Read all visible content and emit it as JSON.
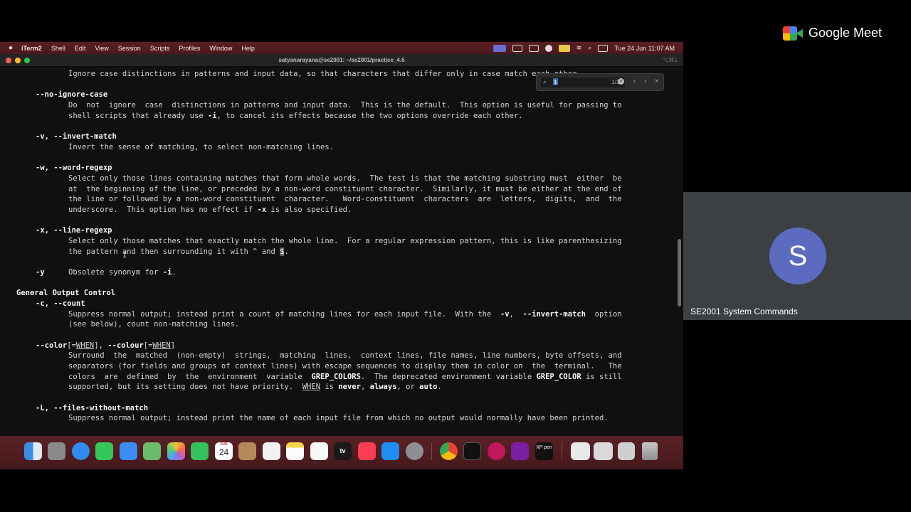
{
  "menubar": {
    "app_name": "iTerm2",
    "items": [
      "Shell",
      "Edit",
      "View",
      "Session",
      "Scripts",
      "Profiles",
      "Window",
      "Help"
    ],
    "clock": "Tue 24 Jun  11:07 AM"
  },
  "window": {
    "title": "satyanarayana@se2001: ~/se2001/practice_4.6",
    "shortcut": "⌥⌘1"
  },
  "find": {
    "query": "$",
    "count": "1/2"
  },
  "terminal": {
    "l01": "Ignore case distinctions in patterns and input data, so that characters that differ only in case match each other.",
    "l02": "--no-ignore-case",
    "l03a": "Do  not  ignore  case  distinctions in patterns and input data.  This is the default.  This option is useful for passing to",
    "l03b": "shell scripts that already use ",
    "l03c": "-i",
    "l03d": ", to cancel its effects because the two options override each other.",
    "l04": "-v, --invert-match",
    "l05": "Invert the sense of matching, to select non-matching lines.",
    "l06": "-w, --word-regexp",
    "l07": "Select only those lines containing matches that form whole words.  The test is that the matching substring must  either  be",
    "l08": "at  the beginning of the line, or preceded by a non-word constituent character.  Similarly, it must be either at the end of",
    "l09": "the line or followed by a non-word constituent  character.   Word-constituent  characters  are  letters,  digits,  and  the",
    "l10a": "underscore.  This option has no effect if ",
    "l10b": "-x",
    "l10c": " is also specified.",
    "l11": "-x, --line-regexp",
    "l12": "Select only those matches that exactly match the whole line.  For a regular expression pattern, this is like parenthesizing",
    "l13a": "the pattern and then surrounding it with ^ and ",
    "l13b": "$",
    "l13c": ".",
    "l14a": "-y",
    "l14b": "Obsolete synonym for ",
    "l14c": "-i",
    "l14d": ".",
    "l15": "General Output Control",
    "l16": "-c, --count",
    "l17a": "Suppress normal output; instead print a count of matching lines for each input file.  With the  ",
    "l17b": "-v",
    "l17c": ",  ",
    "l17d": "--invert-match",
    "l17e": "  option",
    "l18": "(see below), count non-matching lines.",
    "l19a": "--color",
    "l19b": "[=",
    "l19c": "WHEN",
    "l19d": "], ",
    "l19e": "--colour",
    "l19f": "[=",
    "l19g": "WHEN",
    "l19h": "]",
    "l20": "Surround  the  matched  (non-empty)  strings,  matching  lines,  context lines, file names, line numbers, byte offsets, and",
    "l21": "separators (for fields and groups of context lines) with escape sequences to display them in color on  the  terminal.   The",
    "l22a": "colors  are  defined  by  the  environment  variable  ",
    "l22b": "GREP_COLORS",
    "l22c": ".  The deprecated environment variable ",
    "l22d": "GREP_COLOR",
    "l22e": " is still",
    "l23a": "supported, but its setting does not have priority.  ",
    "l23b": "WHEN",
    "l23c": " is ",
    "l23d": "never",
    "l23e": ", ",
    "l23f": "always",
    "l23g": ", or ",
    "l23h": "auto",
    "l23i": ".",
    "l24": "-L, --files-without-match",
    "l25": "Suppress normal output; instead print the name of each input file from which no output would normally have been printed."
  },
  "dock": {
    "icons": [
      "finder-icon",
      "launchpad-icon",
      "safari-icon",
      "messages-icon",
      "mail-icon",
      "maps-icon",
      "photos-icon",
      "facetime-icon",
      "calendar-icon",
      "contacts-icon",
      "reminders-icon",
      "notes-icon",
      "freeform-icon",
      "tv-icon",
      "music-icon",
      "app-store-icon",
      "system-settings-icon",
      "chrome-icon",
      "iterm-icon",
      "vscode-icon",
      "onenote-icon",
      "xp-pen-icon"
    ],
    "calendar_month": "JUN",
    "calendar_day": "24",
    "tv_label": "tv",
    "xppen_label": "XP pen"
  },
  "meet": {
    "brand": "Google Meet",
    "participant_initial": "S",
    "participant_name": "SE2001 System Commands"
  },
  "colors": {
    "menubar": "#4e1b1f",
    "terminal_bg": "#101010",
    "meet_tile": "#3c4043",
    "avatar": "#5c6bc0"
  }
}
